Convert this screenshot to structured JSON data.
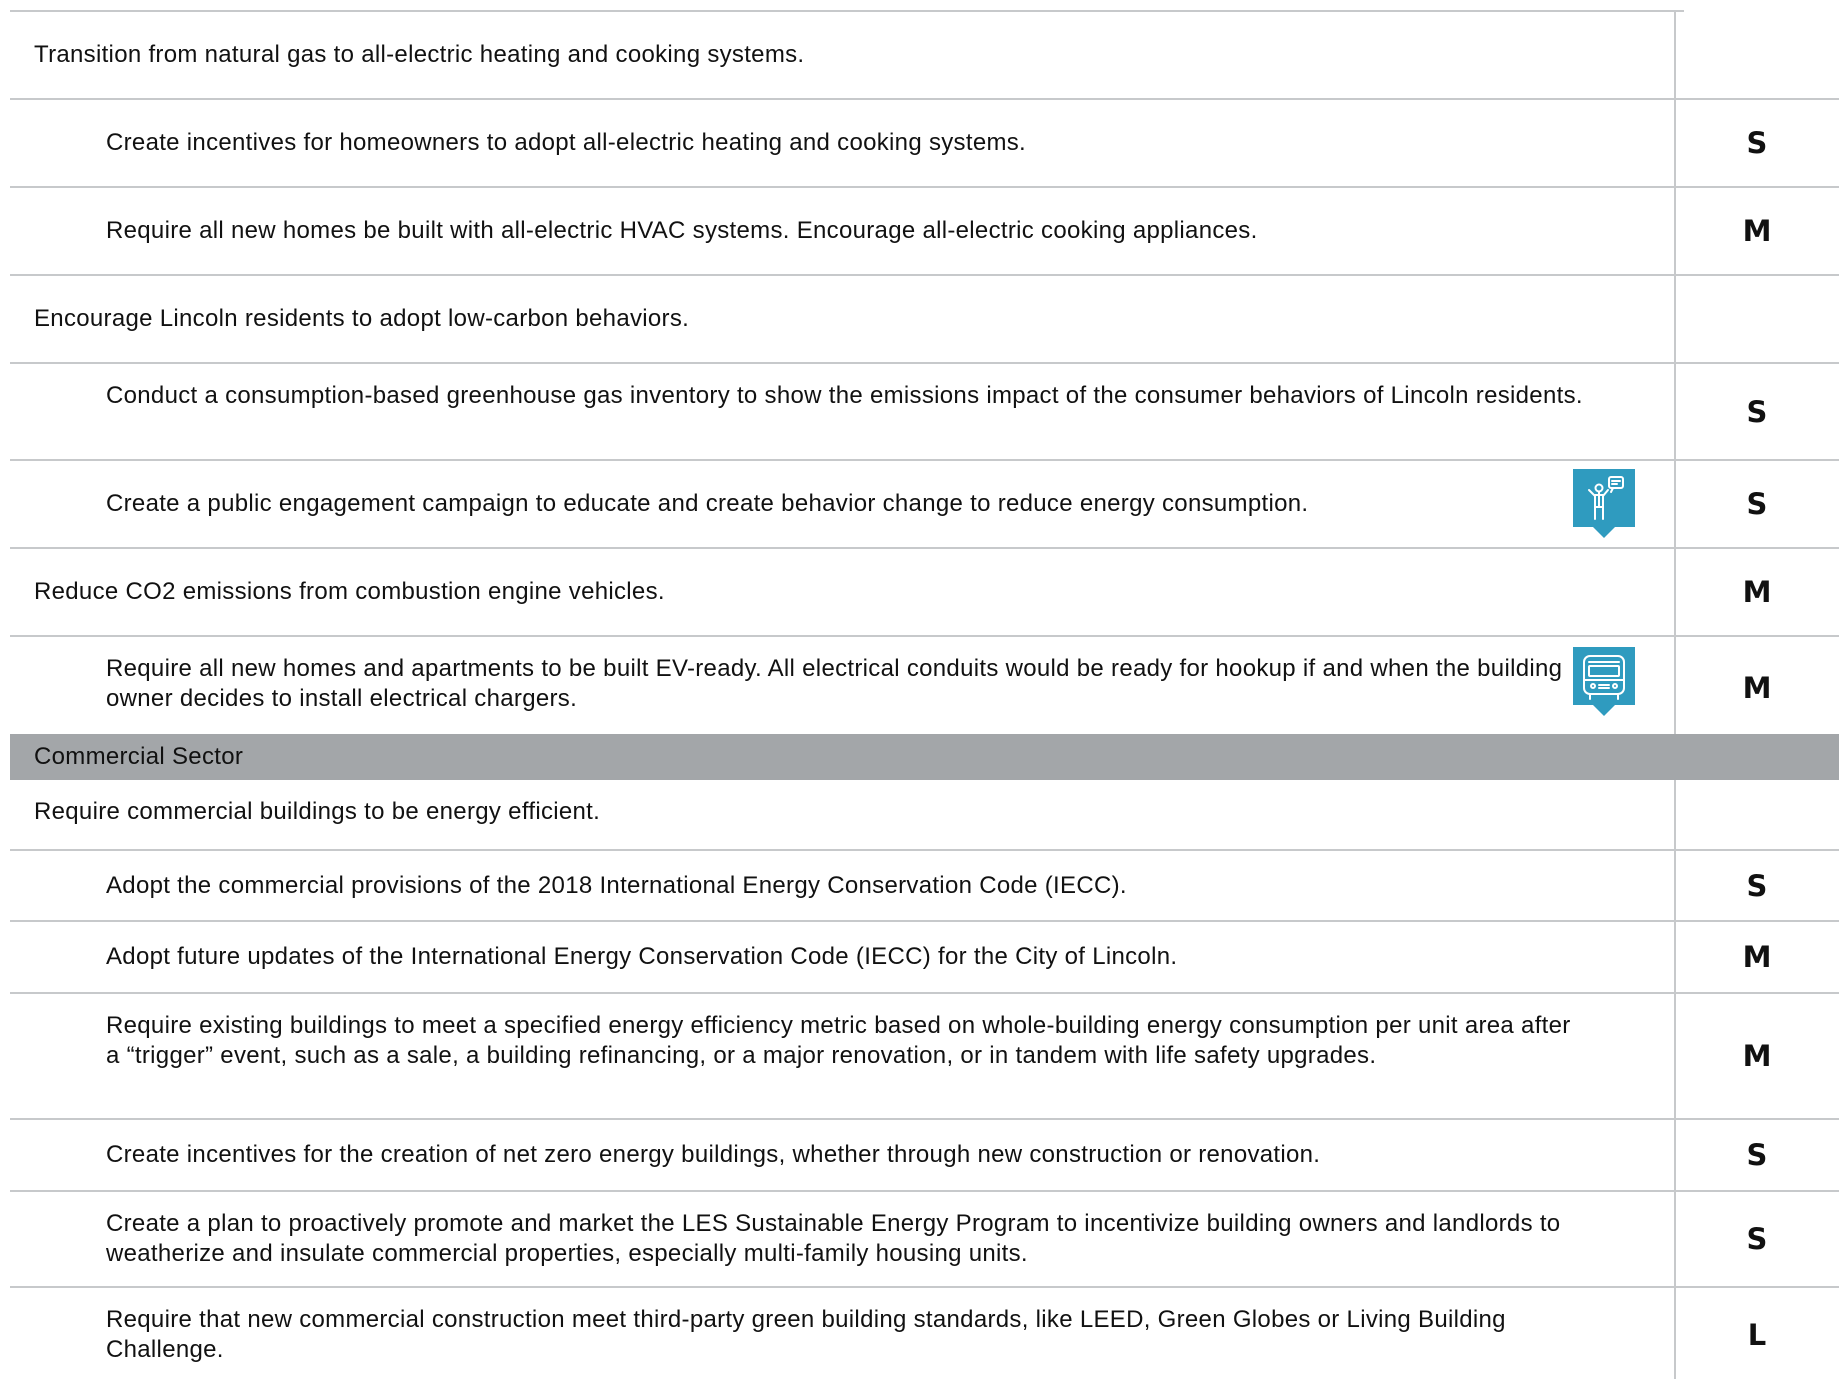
{
  "rows": [
    {
      "kind": "goal",
      "text": "Transition from natural gas to all-electric heating and cooking systems.",
      "timeframe": ""
    },
    {
      "kind": "action",
      "text": "Create incentives for homeowners to adopt all-electric heating and cooking systems.",
      "timeframe": "S"
    },
    {
      "kind": "action",
      "text": "Require all new homes be built with all-electric HVAC systems. Encourage all-electric cooking appliances.",
      "timeframe": "M"
    },
    {
      "kind": "goal",
      "text": "Encourage Lincoln residents to adopt low-carbon behaviors.",
      "timeframe": ""
    },
    {
      "kind": "action",
      "text": "Conduct a consumption-based greenhouse gas inventory to show the emissions impact of the consumer behaviors of Lincoln residents.",
      "timeframe": "S"
    },
    {
      "kind": "action",
      "text": "Create a public engagement campaign to educate and create behavior change to reduce energy consumption.",
      "timeframe": "S",
      "icon": "public-engagement-icon"
    },
    {
      "kind": "goal",
      "text": "Reduce CO2 emissions from combustion engine vehicles.",
      "timeframe": "M"
    },
    {
      "kind": "action",
      "text": "Require all new homes and apartments to be built EV-ready. All electrical conduits would be ready for hookup if and when the building owner decides to install electrical chargers.",
      "timeframe": "M",
      "icon": "bus-icon"
    },
    {
      "kind": "section",
      "text": "Commercial Sector"
    },
    {
      "kind": "goal",
      "text": "Require commercial buildings to be energy efficient.",
      "timeframe": ""
    },
    {
      "kind": "action",
      "text": "Adopt the commercial provisions of the 2018 International Energy Conservation Code (IECC).",
      "timeframe": "S"
    },
    {
      "kind": "action",
      "text": "Adopt future updates of the International Energy Conservation Code (IECC) for the City of Lincoln.",
      "timeframe": "M"
    },
    {
      "kind": "action",
      "text": "Require existing buildings to meet a specified energy efficiency metric based on whole-building energy consumption per unit area after a “trigger” event, such as a sale, a building refinancing, or a major renovation, or in tandem with life safety upgrades.",
      "timeframe": "M"
    },
    {
      "kind": "action",
      "text": "Create incentives for the creation of net zero energy buildings, whether through new construction or renovation.",
      "timeframe": "S"
    },
    {
      "kind": "action",
      "text": "Create a plan to proactively promote and market the LES Sustainable Energy Program to incentivize building owners and landlords to weatherize and insulate commercial properties, especially multi-family housing units.",
      "timeframe": "S"
    },
    {
      "kind": "action",
      "text": "Require that new commercial construction meet third-party green building standards, like LEED, Green Globes or Living Building Challenge.",
      "timeframe": "L"
    }
  ],
  "colors": {
    "badge": "#2f9bbf",
    "section_bg": "#a3a6a9",
    "rule": "#c7c9cb"
  }
}
